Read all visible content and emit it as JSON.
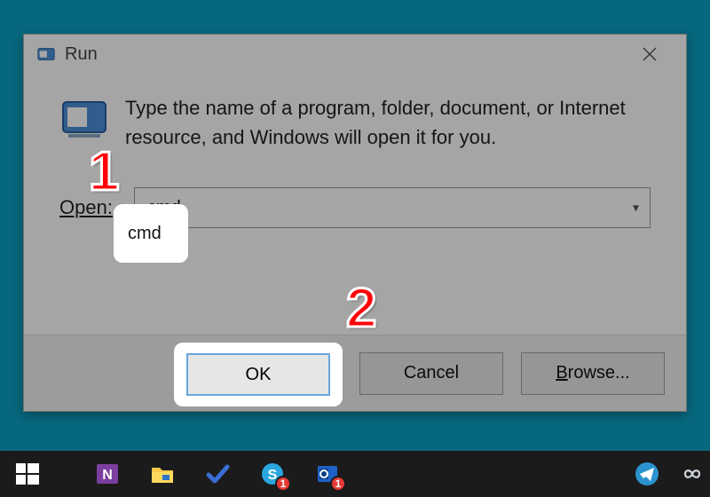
{
  "dialog": {
    "title": "Run",
    "instruction": "Type the name of a program, folder, document, or Internet resource, and Windows will open it for you.",
    "open_label": "Open:",
    "open_value": "cmd",
    "buttons": {
      "ok": "OK",
      "cancel": "Cancel",
      "browse": "Browse..."
    }
  },
  "callouts": {
    "one": "1",
    "two": "2"
  },
  "taskbar": {
    "badges": {
      "skype": "1",
      "outlook": "1"
    }
  }
}
